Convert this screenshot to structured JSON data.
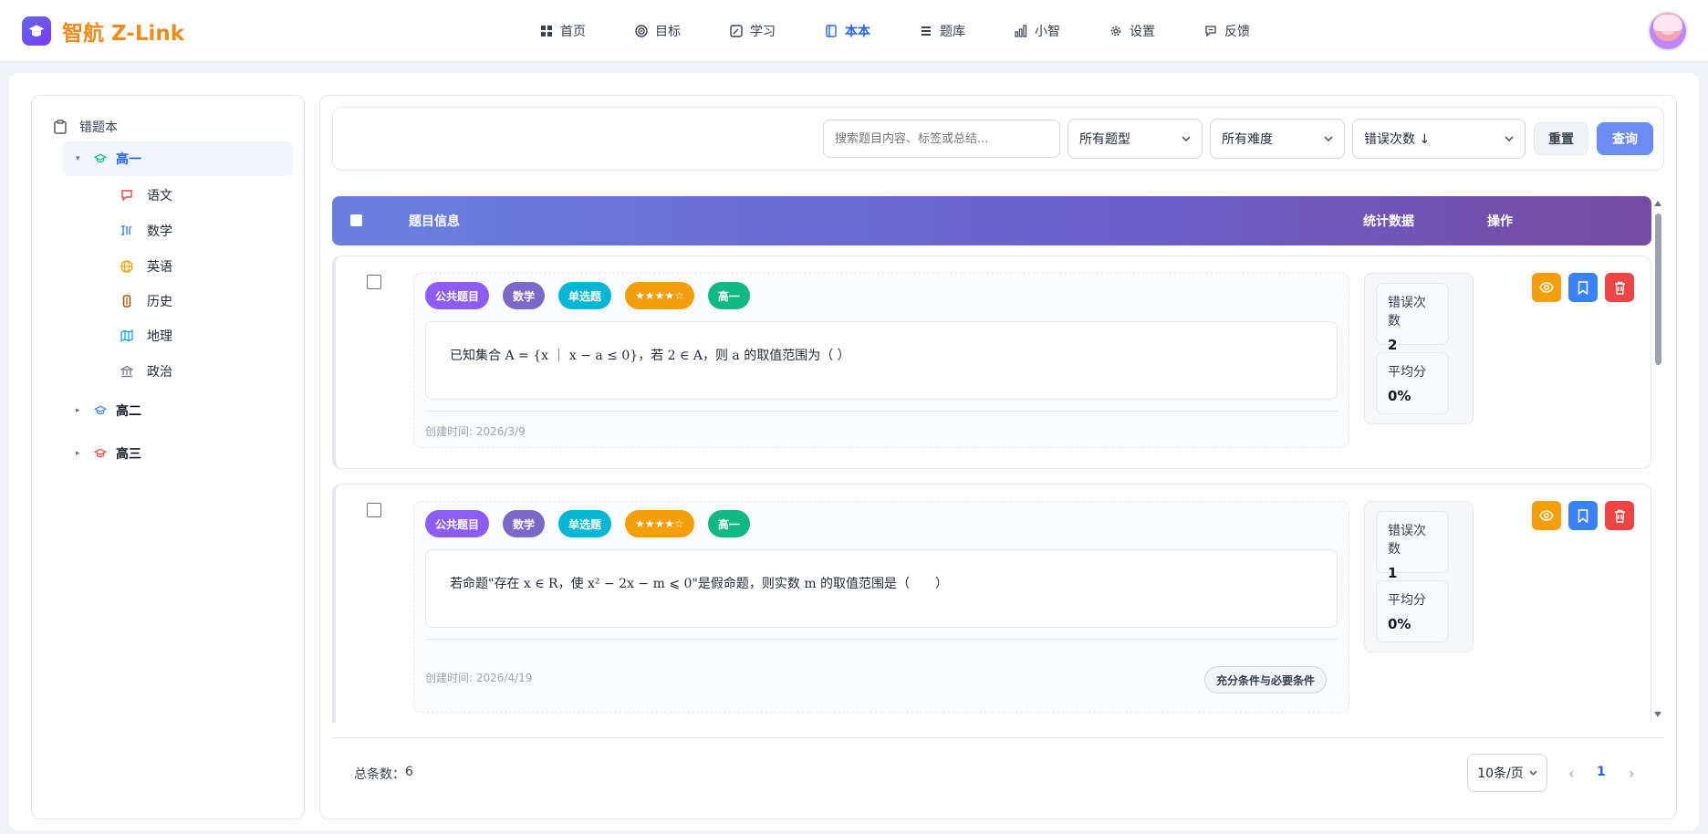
{
  "app": {
    "name": "智航 Z-Link"
  },
  "nav": [
    {
      "label": "首页",
      "icon": "grid-icon"
    },
    {
      "label": "目标",
      "icon": "target-icon"
    },
    {
      "label": "学习",
      "icon": "edit-icon"
    },
    {
      "label": "本本",
      "icon": "book-icon",
      "active": true
    },
    {
      "label": "题库",
      "icon": "list-icon"
    },
    {
      "label": "小智",
      "icon": "bar-chart-icon"
    },
    {
      "label": "设置",
      "icon": "gear-icon"
    },
    {
      "label": "反馈",
      "icon": "chat-icon"
    }
  ],
  "sidebar": {
    "root": "错题本",
    "grades": [
      {
        "label": "高一",
        "expanded": true,
        "color": "#10b981"
      },
      {
        "label": "高二",
        "expanded": false,
        "color": "#3b82f6"
      },
      {
        "label": "高三",
        "expanded": false,
        "color": "#ef4444"
      }
    ],
    "subjects": [
      {
        "label": "语文",
        "icon": "chat-bubble-icon",
        "color": "#ef4444"
      },
      {
        "label": "数学",
        "icon": "sigma-icon",
        "color": "#3b82f6"
      },
      {
        "label": "英语",
        "icon": "globe-icon",
        "color": "#f59e0b"
      },
      {
        "label": "历史",
        "icon": "scroll-icon",
        "color": "#92400e"
      },
      {
        "label": "地理",
        "icon": "map-icon",
        "color": "#0ea5e9"
      },
      {
        "label": "政治",
        "icon": "landmark-icon",
        "color": "#6b7280"
      }
    ]
  },
  "filters": {
    "search_placeholder": "搜索题目内容、标签或总结...",
    "type": "所有题型",
    "difficulty": "所有难度",
    "sort": "错误次数 ↓",
    "reset": "重置",
    "query": "查询"
  },
  "table": {
    "headers": {
      "info": "题目信息",
      "stats": "统计数据",
      "ops": "操作"
    },
    "rows": [
      {
        "tags": [
          "公共题目",
          "数学",
          "单选题",
          "★★★★☆",
          "高一"
        ],
        "question": "已知集合 A = {x ｜ x − a ≤ 0}，若 2 ∈ A，则 a 的取值范围为（ ）",
        "created": "创建时间: 2026/3/9",
        "knowledge": "",
        "error_label": "错误次数",
        "error_count": "2",
        "avg_label": "平均分",
        "avg": "0%"
      },
      {
        "tags": [
          "公共题目",
          "数学",
          "单选题",
          "★★★★☆",
          "高一"
        ],
        "question": "若命题\"存在 x ∈ R，使 x² − 2x − m ⩽ 0\"是假命题，则实数 m 的取值范围是（　　）",
        "created": "创建时间: 2026/4/19",
        "knowledge": "充分条件与必要条件",
        "error_label": "错误次数",
        "error_count": "1",
        "avg_label": "平均分",
        "avg": "0%"
      }
    ]
  },
  "tag_colors": [
    "#8b5cf6",
    "#7c68c8",
    "#06b6d4",
    "#f59e0b",
    "#10b981"
  ],
  "footer": {
    "total_label": "总条数：",
    "total": "6",
    "page_size": "10条/页",
    "page": "1",
    "prev": "‹",
    "next": "›"
  }
}
